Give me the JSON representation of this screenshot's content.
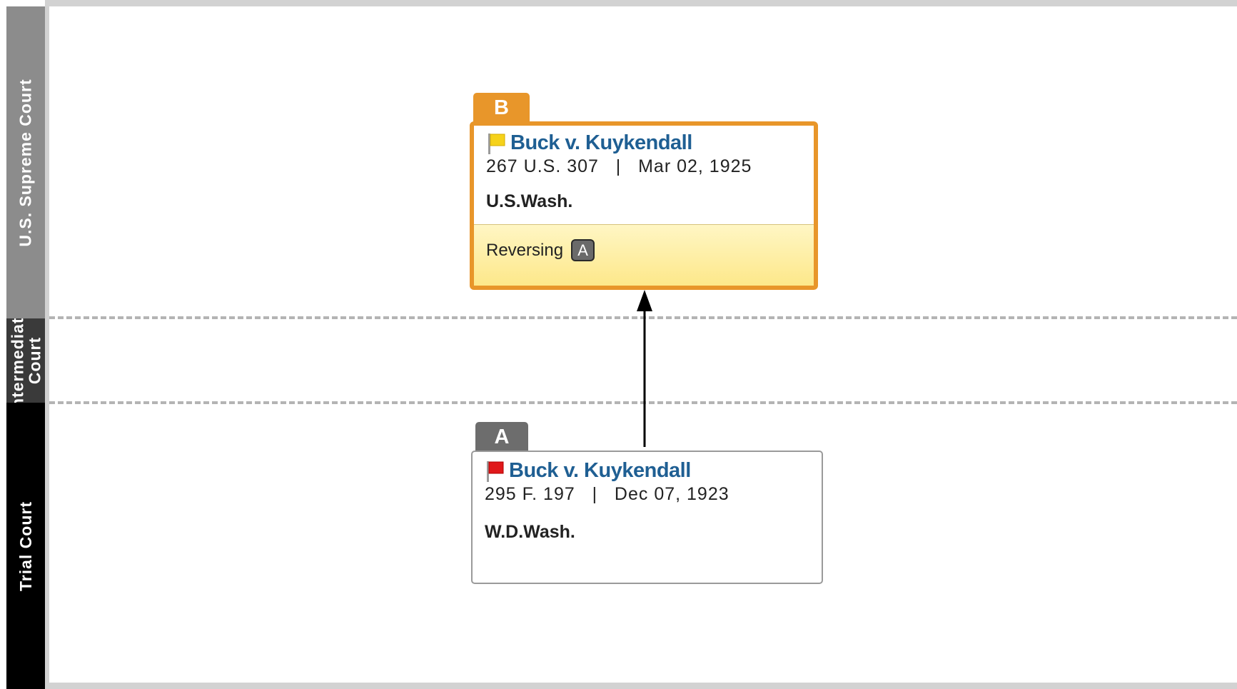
{
  "lanes": {
    "supreme": "U.S. Supreme Court",
    "intermediate_line1": "Intermediate",
    "intermediate_line2": "Court",
    "trial": "Trial Court"
  },
  "colors": {
    "accent_orange": "#e8962a",
    "title_blue": "#1f5f93",
    "tab_gray": "#6d6d6d",
    "flag_yellow": "#f6d21a",
    "flag_red": "#e0181a"
  },
  "cases": [
    {
      "tab_letter": "B",
      "flag": "yellow-flag-icon",
      "title": "Buck v. Kuykendall",
      "citation": "267 U.S. 307   |   Mar 02, 1925",
      "court": "U.S.Wash.",
      "treatment": "Reversing",
      "treatment_ref": "A"
    },
    {
      "tab_letter": "A",
      "flag": "red-flag-icon",
      "title": "Buck v. Kuykendall",
      "citation": "295 F. 197   |   Dec 07, 1923",
      "court": "W.D.Wash."
    }
  ]
}
